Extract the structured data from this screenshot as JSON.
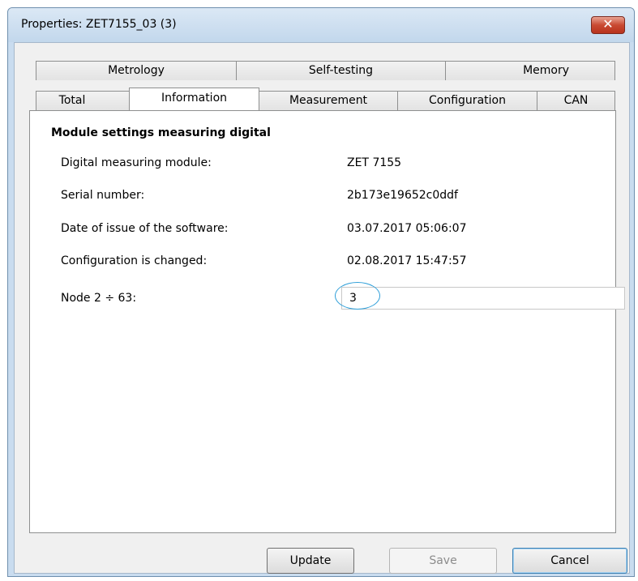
{
  "window": {
    "title": "Properties: ZET7155_03 (3)",
    "close_symbol": "✕"
  },
  "tabs_back": [
    {
      "label": "Metrology"
    },
    {
      "label": "Self-testing"
    },
    {
      "label": "Memory"
    }
  ],
  "tabs_front": [
    {
      "label": "Total"
    },
    {
      "label": "Information",
      "active": true
    },
    {
      "label": "Measurement"
    },
    {
      "label": "Configuration"
    },
    {
      "label": "CAN"
    }
  ],
  "panel": {
    "title": "Module settings measuring digital",
    "rows": [
      {
        "label": "Digital measuring module:",
        "value": "ZET 7155"
      },
      {
        "label": "Serial number:",
        "value": "2b173e19652c0ddf"
      },
      {
        "label": "Date of issue of the software:",
        "value": "03.07.2017 05:06:07"
      },
      {
        "label": "Configuration is changed:",
        "value": "02.08.2017 15:47:57"
      }
    ],
    "node": {
      "label": "Node 2 ÷ 63:",
      "value": "3"
    }
  },
  "buttons": {
    "update": "Update",
    "save": "Save",
    "cancel": "Cancel"
  },
  "colors": {
    "highlight_ellipse": "#2f9fd9",
    "title_bar": "#c9dcef",
    "close_button": "#c94a32"
  }
}
